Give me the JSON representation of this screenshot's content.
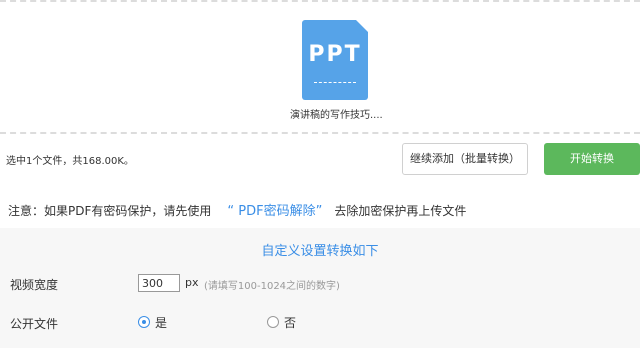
{
  "file": {
    "icon_text": "PPT",
    "name": "演讲稿的写作技巧...."
  },
  "status": {
    "selected_info": "选中1个文件，共168.00K。",
    "batch_button": "继续添加（批量转换）",
    "start_button": "开始转换"
  },
  "notice": {
    "prefix": "注意：如果PDF有密码保护，请先使用",
    "link": "“ PDF密码解除”",
    "suffix": "去除加密保护再上传文件"
  },
  "settings": {
    "title": "自定义设置转换如下",
    "width": {
      "label": "视频宽度",
      "value": "300",
      "unit": "px",
      "hint": "(请填写100-1024之间的数字)"
    },
    "public": {
      "label": "公开文件",
      "options": [
        "是",
        "否"
      ],
      "selected": "是"
    }
  },
  "colors": {
    "accent": "#3a8ee6",
    "start_button": "#5cb85c",
    "file_icon": "#56a3e8"
  }
}
